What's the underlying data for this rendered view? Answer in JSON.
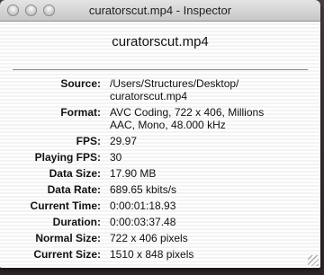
{
  "window": {
    "title": "curatorscut.mp4 - Inspector",
    "buttons": [
      "close",
      "minimize",
      "zoom"
    ]
  },
  "header": {
    "filename": "curatorscut.mp4"
  },
  "info": {
    "source": {
      "label": "Source:",
      "lines": [
        "/Users/Structures/Desktop/",
        "curatorscut.mp4"
      ]
    },
    "format": {
      "label": "Format:",
      "lines": [
        "AVC Coding, 722 x 406, Millions",
        "AAC, Mono, 48.000 kHz"
      ]
    },
    "fps": {
      "label": "FPS:",
      "value": "29.97"
    },
    "playing_fps": {
      "label": "Playing FPS:",
      "value": "30"
    },
    "data_size": {
      "label": "Data Size:",
      "value": "17.90 MB"
    },
    "data_rate": {
      "label": "Data Rate:",
      "value": "689.65 kbits/s"
    },
    "current_time": {
      "label": "Current Time:",
      "value": "0:00:01:18.93"
    },
    "duration": {
      "label": "Duration:",
      "value": "0:00:03:37.48"
    },
    "normal_size": {
      "label": "Normal Size:",
      "value": "722 x 406 pixels"
    },
    "current_size": {
      "label": "Current Size:",
      "value": "1510 x 848 pixels"
    }
  }
}
